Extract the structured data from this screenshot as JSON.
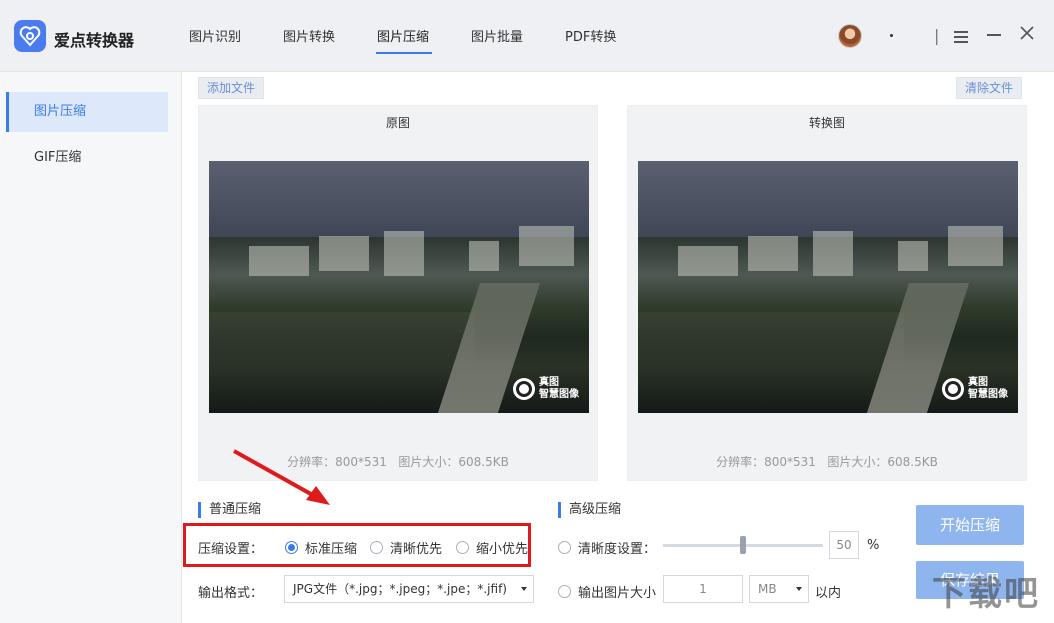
{
  "app": {
    "title": "爱点转换器"
  },
  "nav": {
    "tabs": [
      "图片识别",
      "图片转换",
      "图片压缩",
      "图片批量",
      "PDF转换"
    ],
    "active": "图片压缩"
  },
  "window": {
    "dot": "。",
    "divider": "|"
  },
  "sidebar": {
    "items": [
      {
        "label": "图片压缩",
        "active": true
      },
      {
        "label": "GIF压缩",
        "active": false
      }
    ]
  },
  "toolbar": {
    "add_file": "添加文件",
    "clear_files": "清除文件"
  },
  "panels": {
    "original": {
      "title": "原图",
      "resolution_label": "分辨率：",
      "resolution": "800*531",
      "size_label": "图片大小：",
      "size": "608.5KB"
    },
    "converted": {
      "title": "转换图",
      "resolution_label": "分辨率：",
      "resolution": "800*531",
      "size_label": "图片大小：",
      "size": "608.5KB"
    },
    "watermark": {
      "line1": "真图",
      "line2": "智慧图像"
    }
  },
  "basic": {
    "section": "普通压缩",
    "compress_label": "压缩设置：",
    "options": [
      {
        "label": "标准压缩",
        "checked": true
      },
      {
        "label": "清晰优先",
        "checked": false
      },
      {
        "label": "缩小优先",
        "checked": false
      }
    ],
    "format_label": "输出格式：",
    "format_value": "JPG文件（*.jpg；*.jpeg；*.jpe；*.jfif)"
  },
  "advanced": {
    "section": "高级压缩",
    "clarity_label": "清晰度设置：",
    "clarity_value": "50",
    "clarity_unit": "%",
    "size_label": "输出图片大小",
    "size_value": "1",
    "size_unit": "MB",
    "size_suffix": "以内"
  },
  "actions": {
    "start": "开始压缩",
    "save": "保存结果"
  },
  "corner_watermark": "下载吧",
  "colors": {
    "accent": "#3b7be8",
    "highlight": "#e0191b",
    "button": "#8fb5ef"
  }
}
